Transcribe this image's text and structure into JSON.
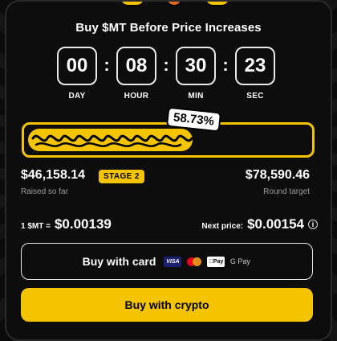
{
  "header": {
    "title": "Buy $MT Before Price Increases"
  },
  "timer": {
    "days": "00",
    "hours": "08",
    "minutes": "30",
    "seconds": "23",
    "labels": {
      "day": "DAY",
      "hour": "HOUR",
      "min": "MIN",
      "sec": "SEC"
    }
  },
  "progress": {
    "percent_label": "58.73%",
    "percent_value": 58.73
  },
  "raised": {
    "amount": "$46,158.14",
    "label": "Raised so far",
    "stage": "STAGE 2"
  },
  "target": {
    "amount": "$78,590.46",
    "label": "Round target"
  },
  "price": {
    "current_label": "1 $MT =",
    "current_value": "$0.00139",
    "next_label": "Next price:",
    "next_value": "$0.00154",
    "info_glyph": "i"
  },
  "buttons": {
    "card_label": "Buy with card",
    "crypto_label": "Buy with crypto",
    "card_icons": {
      "visa": "VISA",
      "apple_pay": "Pay",
      "google_pay": "G Pay"
    }
  },
  "colors": {
    "accent": "#f5c400",
    "background": "#0d0d0d",
    "text": "#ffffff",
    "muted": "#9a9a9a"
  }
}
